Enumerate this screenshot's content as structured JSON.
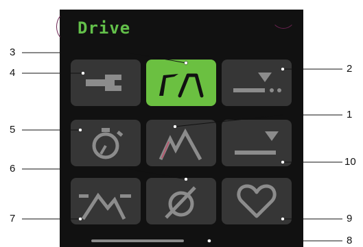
{
  "screen": {
    "title": "Drive",
    "accent_color": "#6bc041",
    "tile_color": "#363636",
    "background_color": "#111111"
  },
  "tiles": [
    {
      "icon": "wrench-icon",
      "active": false
    },
    {
      "icon": "drive-mode-icon",
      "active": true
    },
    {
      "icon": "level-dropdown-dots-icon",
      "active": false
    },
    {
      "icon": "timer-icon",
      "active": false
    },
    {
      "icon": "mountain-peak-icon",
      "active": false
    },
    {
      "icon": "level-dropdown-icon",
      "active": false
    },
    {
      "icon": "mountain-range-icon",
      "active": false
    },
    {
      "icon": "bypass-icon",
      "active": false
    },
    {
      "icon": "heart-icon",
      "active": false
    }
  ],
  "callouts": [
    "1",
    "2",
    "3",
    "4",
    "5",
    "6",
    "7",
    "8",
    "9",
    "10"
  ]
}
